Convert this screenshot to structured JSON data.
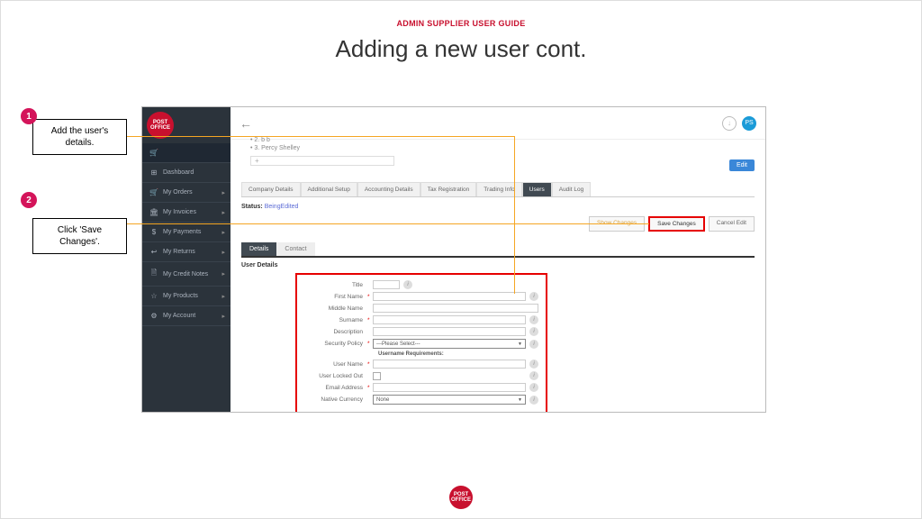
{
  "header": "ADMIN SUPPLIER USER GUIDE",
  "title": "Adding a new user cont.",
  "callouts": {
    "c1_num": "1",
    "c1_text": "Add the user's details.",
    "c2_num": "2",
    "c2_text": "Click 'Save Changes'."
  },
  "logo_text": "POST OFFICE",
  "sidebar": {
    "items": [
      {
        "icon": "⊞",
        "label": "Dashboard",
        "chev": ""
      },
      {
        "icon": "🛒",
        "label": "My Orders",
        "chev": "▸"
      },
      {
        "icon": "🏛",
        "label": "My Invoices",
        "chev": "▸"
      },
      {
        "icon": "$",
        "label": "My Payments",
        "chev": "▸"
      },
      {
        "icon": "↩",
        "label": "My Returns",
        "chev": "▸"
      },
      {
        "icon": "🗎",
        "label": "My Credit Notes",
        "chev": "▸"
      },
      {
        "icon": "☆",
        "label": "My Products",
        "chev": "▸"
      },
      {
        "icon": "⚙",
        "label": "My Account",
        "chev": "▸"
      }
    ]
  },
  "breadcrumbs": {
    "b1": "• 2. b b",
    "b2": "• 3. Percy Shelley",
    "plus": "+"
  },
  "topbar": {
    "user_initials": "PS"
  },
  "edit_btn": "Edit",
  "tabs": {
    "t0": "Company Details",
    "t1": "Additional Setup",
    "t2": "Accounting Details",
    "t3": "Tax Registration",
    "t4": "Trading Info",
    "t5": "Users",
    "t6": "Audit Log"
  },
  "status": {
    "label": "Status:",
    "value": "BeingEdited"
  },
  "actions": {
    "show": "Show Changes",
    "save": "Save Changes",
    "cancel": "Cancel Edit"
  },
  "subtabs": {
    "s0": "Details",
    "s1": "Contact"
  },
  "section": "User Details",
  "form": {
    "title": "Title",
    "first": "First Name",
    "middle": "Middle Name",
    "surname": "Surname",
    "desc": "Description",
    "policy": "Security Policy",
    "policy_val": "---Please Select---",
    "subhead": "Username Requirements:",
    "username": "User Name",
    "locked": "User Locked Out",
    "email": "Email Address",
    "currency": "Native Currency",
    "currency_val": "None"
  }
}
